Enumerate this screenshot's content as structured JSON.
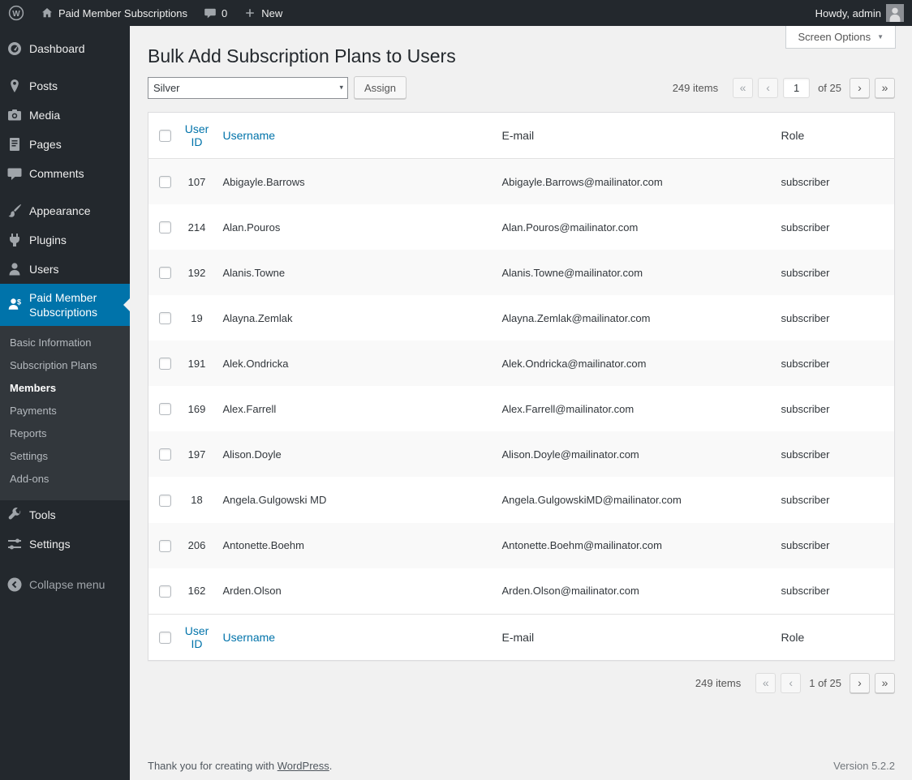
{
  "colors": {
    "accent_link": "#0073aa",
    "admin_bar_bg": "#23282d",
    "sidebar_bg": "#23282d",
    "active_menu_bg": "#0073aa",
    "content_bg": "#f1f1f1",
    "row_stripe": "#f9f9f9"
  },
  "admin_bar": {
    "site_name": "Paid Member Subscriptions",
    "comments_count": "0",
    "new_label": "New",
    "howdy": "Howdy, admin"
  },
  "sidebar": {
    "items": [
      {
        "label": "Dashboard"
      },
      {
        "label": "Posts"
      },
      {
        "label": "Media"
      },
      {
        "label": "Pages"
      },
      {
        "label": "Comments"
      },
      {
        "label": "Appearance"
      },
      {
        "label": "Plugins"
      },
      {
        "label": "Users"
      },
      {
        "label": "Paid Member Subscriptions"
      },
      {
        "label": "Tools"
      },
      {
        "label": "Settings"
      }
    ],
    "pms_submenu": [
      "Basic Information",
      "Subscription Plans",
      "Members",
      "Payments",
      "Reports",
      "Settings",
      "Add-ons"
    ],
    "collapse_label": "Collapse menu"
  },
  "main": {
    "screen_options_label": "Screen Options",
    "title": "Bulk Add Subscription Plans to Users",
    "plan_select": {
      "selected": "Silver"
    },
    "assign_button": "Assign",
    "top_pagination": {
      "items_text": "249 items",
      "first": "«",
      "prev": "‹",
      "current_page": "1",
      "of_text": "of 25",
      "next": "›",
      "last": "»"
    },
    "table": {
      "headers": {
        "user_id": "User ID",
        "username": "Username",
        "email": "E-mail",
        "role": "Role"
      },
      "rows": [
        {
          "user_id": "107",
          "username": "Abigayle.Barrows",
          "email": "Abigayle.Barrows@mailinator.com",
          "role": "subscriber"
        },
        {
          "user_id": "214",
          "username": "Alan.Pouros",
          "email": "Alan.Pouros@mailinator.com",
          "role": "subscriber"
        },
        {
          "user_id": "192",
          "username": "Alanis.Towne",
          "email": "Alanis.Towne@mailinator.com",
          "role": "subscriber"
        },
        {
          "user_id": "19",
          "username": "Alayna.Zemlak",
          "email": "Alayna.Zemlak@mailinator.com",
          "role": "subscriber"
        },
        {
          "user_id": "191",
          "username": "Alek.Ondricka",
          "email": "Alek.Ondricka@mailinator.com",
          "role": "subscriber"
        },
        {
          "user_id": "169",
          "username": "Alex.Farrell",
          "email": "Alex.Farrell@mailinator.com",
          "role": "subscriber"
        },
        {
          "user_id": "197",
          "username": "Alison.Doyle",
          "email": "Alison.Doyle@mailinator.com",
          "role": "subscriber"
        },
        {
          "user_id": "18",
          "username": "Angela.Gulgowski MD",
          "email": "Angela.GulgowskiMD@mailinator.com",
          "role": "subscriber"
        },
        {
          "user_id": "206",
          "username": "Antonette.Boehm",
          "email": "Antonette.Boehm@mailinator.com",
          "role": "subscriber"
        },
        {
          "user_id": "162",
          "username": "Arden.Olson",
          "email": "Arden.Olson@mailinator.com",
          "role": "subscriber"
        }
      ]
    },
    "bottom_pagination": {
      "items_text": "249 items",
      "first": "«",
      "prev": "‹",
      "page_text": "1 of 25",
      "next": "›",
      "last": "»"
    }
  },
  "footer": {
    "thanks_text": "Thank you for creating with",
    "wordpress_link": "WordPress",
    "period": ".",
    "version": "Version 5.2.2"
  }
}
